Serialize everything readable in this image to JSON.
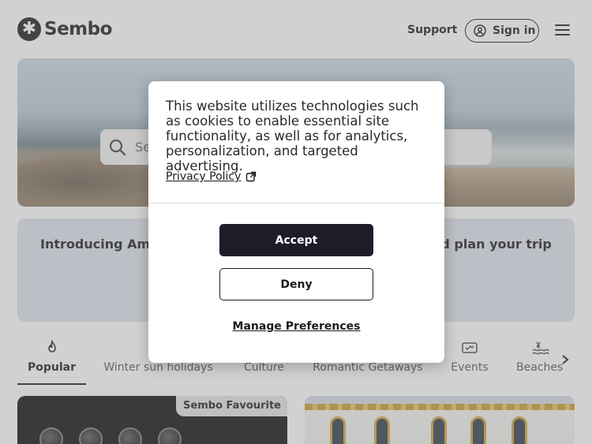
{
  "header": {
    "brand": "Sembo",
    "support_label": "Support",
    "signin_label": "Sign in"
  },
  "hero": {
    "search_placeholder": "Se"
  },
  "promo": {
    "left_text": "Introducing Ame",
    "right_text": "nd plan your trip"
  },
  "categories": {
    "items": [
      {
        "label": "Popular",
        "icon": "flame-icon",
        "active": true
      },
      {
        "label": "Winter sun holidays",
        "icon": "sun-icon",
        "active": false
      },
      {
        "label": "Culture",
        "icon": "culture-icon",
        "active": false
      },
      {
        "label": "Romantic Getaways",
        "icon": "heart-icon",
        "active": false
      },
      {
        "label": "Events",
        "icon": "ticket-icon",
        "active": false
      },
      {
        "label": "Beaches",
        "icon": "beach-icon",
        "active": false
      }
    ]
  },
  "listings": {
    "badge": "Sembo Favourite"
  },
  "cookie_dialog": {
    "message": "This website utilizes technologies such as cookies to enable essential site functionality, as well as for analytics, personalization, and targeted advertising.",
    "privacy_label": "Privacy Policy",
    "accept_label": "Accept",
    "deny_label": "Deny",
    "manage_label": "Manage Preferences"
  },
  "colors": {
    "primary": "#1d1d2a",
    "promo_bg": "#dfe3ee",
    "overlay": "#878787"
  }
}
